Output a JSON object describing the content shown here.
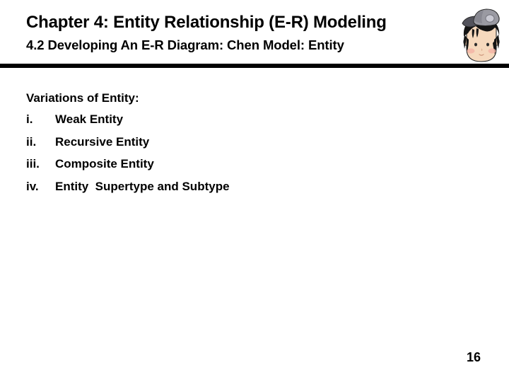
{
  "slide": {
    "title": "Chapter 4: Entity Relationship (E-R) Modeling",
    "subtitle": "4.2 Developing An E-R Diagram: Chen Model: Entity",
    "page_number": "16"
  },
  "content": {
    "lead": "Variations of Entity:",
    "items": [
      {
        "marker": "i.",
        "text": "Weak Entity"
      },
      {
        "marker": "ii.",
        "text": "Recursive Entity"
      },
      {
        "marker": "iii.",
        "text": "Composite Entity"
      },
      {
        "marker": "iv.",
        "text": "Entity  Supertype and Subtype"
      }
    ]
  },
  "avatar": {
    "name": "student-avatar-icon",
    "description": "Cartoon student with gray cap and black hair",
    "colors": {
      "cap": "#9a9aa2",
      "cap_shadow": "#6e6e77",
      "cap_brim": "#53535c",
      "cap_patch": "#c9c9d2",
      "hair": "#141414",
      "skin": "#f6d9bd",
      "cheek": "#f3b4a6",
      "outline": "#2b2b2b"
    }
  },
  "theme": {
    "background": "#ffffff",
    "text": "#000000",
    "divider": "#000000"
  }
}
